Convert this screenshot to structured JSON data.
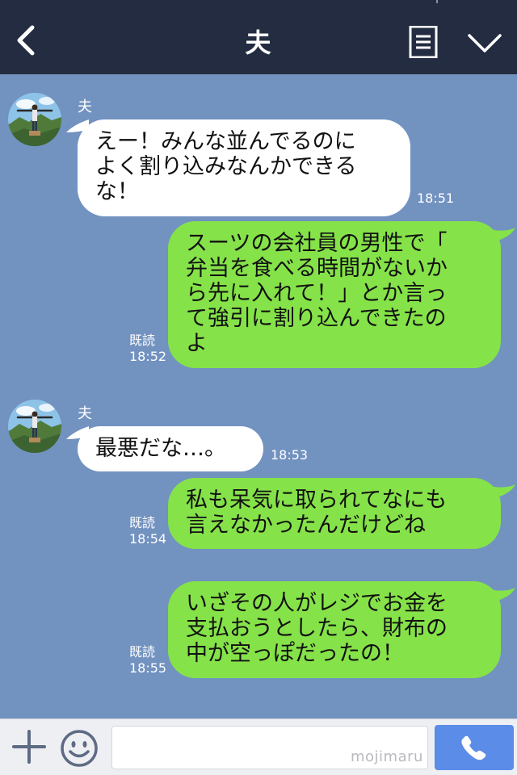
{
  "header": {
    "title": "夫"
  },
  "messages": [
    {
      "side": "in",
      "sender": "夫",
      "text": "えー！みんな並んでるのに\nよく割り込みなんかできる\nな！",
      "time": "18:51"
    },
    {
      "side": "out",
      "read": "既読",
      "text": "スーツの会社員の男性で「\n弁当を食べる時間がないか\nら先に入れて！」とか言っ\nて強引に割り込んできたの\nよ",
      "time": "18:52"
    },
    {
      "side": "in",
      "sender": "夫",
      "text": "最悪だな…。",
      "time": "18:53"
    },
    {
      "side": "out",
      "read": "既読",
      "text": "私も呆気に取られてなにも\n言えなかったんだけどね",
      "time": "18:54"
    },
    {
      "side": "out",
      "read": "既読",
      "text": "いざその人がレジでお金を\n支払おうとしたら、財布の\n中が空っぽだったの！",
      "time": "18:55"
    }
  ],
  "footer": {
    "watermark": "mojimaru"
  },
  "icons": {
    "back": "back-icon",
    "menu": "menu-icon",
    "dropdown": "chevron-down-icon",
    "plus": "plus-icon",
    "emoji": "smiley-icon",
    "call": "phone-icon"
  },
  "colors": {
    "header": "#232c40",
    "background": "#7292c0",
    "incoming_bubble": "#ffffff",
    "outgoing_bubble": "#85e249",
    "call_button": "#5a8ce8"
  }
}
